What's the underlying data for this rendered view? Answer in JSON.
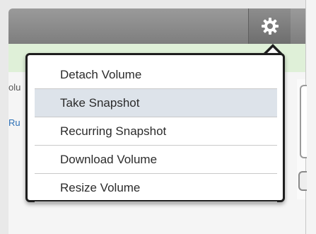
{
  "header": {
    "gear_icon": "gear-icon"
  },
  "background": {
    "volume_label_fragment": "olu",
    "run_link_fragment": "Ru"
  },
  "menu": {
    "items": [
      {
        "label": "Detach Volume",
        "selected": false
      },
      {
        "label": "Take Snapshot",
        "selected": true
      },
      {
        "label": "Recurring Snapshot",
        "selected": false
      },
      {
        "label": "Download Volume",
        "selected": false
      },
      {
        "label": "Resize Volume",
        "selected": false
      }
    ]
  },
  "colors": {
    "header": "#8a8a8a",
    "info_strip": "#dff0d8",
    "menu_border": "#1e1e1e",
    "menu_highlight": "#dde3ea",
    "link": "#2a6eb5"
  }
}
